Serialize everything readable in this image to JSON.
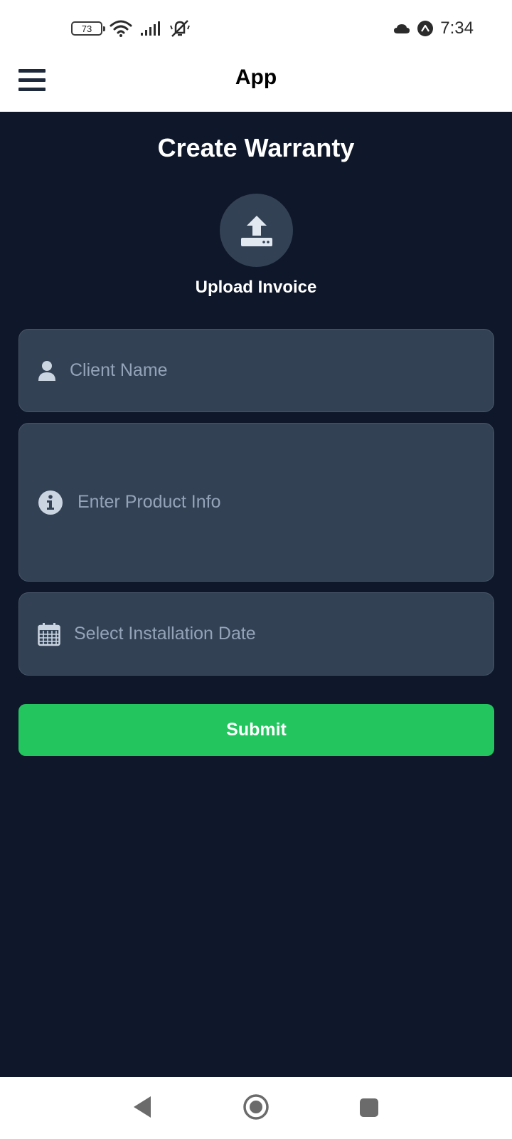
{
  "status_bar": {
    "battery_level": "73",
    "time": "7:34",
    "icons": [
      "battery-icon",
      "wifi-icon",
      "signal-icon",
      "silent-mode-icon",
      "cloud-icon",
      "app-notification-icon"
    ]
  },
  "app_bar": {
    "title": "App",
    "menu_icon": "hamburger-menu-icon"
  },
  "main": {
    "page_title": "Create Warranty",
    "upload": {
      "label": "Upload Invoice",
      "icon": "upload-icon"
    },
    "fields": {
      "client_name": {
        "placeholder": "Client Name",
        "value": "",
        "icon": "user-icon"
      },
      "product_info": {
        "placeholder": "Enter Product Info",
        "value": "",
        "icon": "info-icon"
      },
      "installation_date": {
        "placeholder": "Select Installation Date",
        "value": "",
        "icon": "calendar-icon"
      }
    },
    "submit_label": "Submit"
  },
  "nav_bar": {
    "icons": [
      "back-icon",
      "home-icon",
      "recents-icon"
    ]
  },
  "colors": {
    "background": "#0f172a",
    "field_background": "#334155",
    "accent": "#22c55e",
    "placeholder": "#94a3b8"
  }
}
